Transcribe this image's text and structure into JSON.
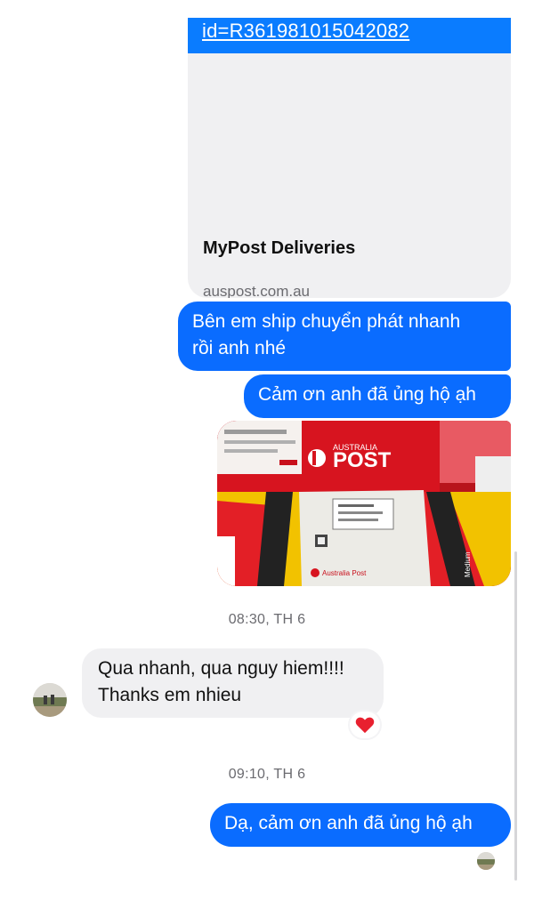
{
  "link_preview": {
    "url_text": "id=R361981015042082",
    "title": "MyPost Deliveries",
    "domain": "auspost.com.au"
  },
  "messages": [
    {
      "direction": "outgoing",
      "lines": [
        "Bên em ship chuyển phát nhanh",
        "rồi anh nhé"
      ]
    },
    {
      "direction": "outgoing",
      "text": "Cảm ơn anh đã ủng hộ ạh"
    },
    {
      "direction": "outgoing",
      "type": "photo",
      "photo": {
        "brand": "AUSTRALIA",
        "brand_main": "POST",
        "label": "Australia Post",
        "size_label": "Medium"
      }
    },
    {
      "direction": "incoming",
      "lines": [
        "Qua nhanh, qua nguy hiem!!!!",
        "Thanks em nhieu"
      ],
      "reaction": "heart"
    },
    {
      "direction": "outgoing",
      "text": "Dạ, cảm ơn anh đã ủng hộ ạh"
    }
  ],
  "timestamps": [
    "08:30, TH 6",
    "09:10, TH 6"
  ],
  "colors": {
    "outgoing_bubble": "#0a6cff",
    "outgoing_bubble_last": "#0a4ce8",
    "incoming_bubble": "#f0f0f2",
    "auspost_red": "#d7141f",
    "reaction_heart": "#e8202f"
  }
}
